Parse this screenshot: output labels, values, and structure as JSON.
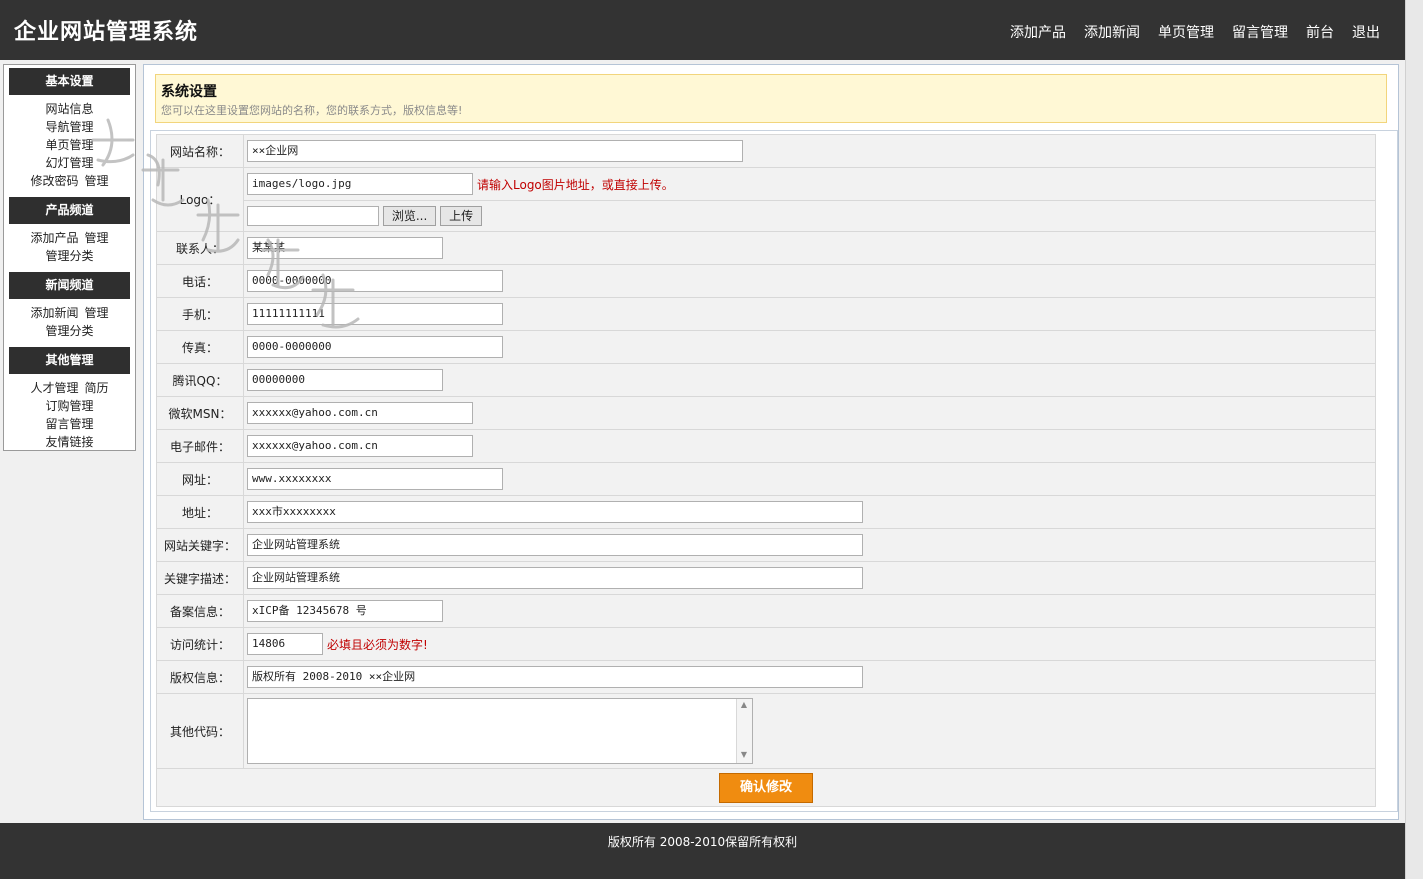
{
  "app_title": "企业网站管理系统",
  "top_nav": [
    "添加产品",
    "添加新闻",
    "单页管理",
    "留言管理",
    "前台",
    "退出"
  ],
  "sidebar": [
    {
      "heading": "基本设置",
      "items": [
        [
          "网站信息"
        ],
        [
          "导航管理"
        ],
        [
          "单页管理"
        ],
        [
          "幻灯管理"
        ],
        [
          "修改密码",
          "管理"
        ]
      ]
    },
    {
      "heading": "产品频道",
      "items": [
        [
          "添加产品",
          "管理"
        ],
        [
          "管理分类"
        ]
      ]
    },
    {
      "heading": "新闻频道",
      "items": [
        [
          "添加新闻",
          "管理"
        ],
        [
          "管理分类"
        ]
      ]
    },
    {
      "heading": "其他管理",
      "items": [
        [
          "人才管理",
          "简历"
        ],
        [
          "订购管理"
        ],
        [
          "留言管理"
        ],
        [
          "友情链接"
        ]
      ]
    }
  ],
  "notice": {
    "title": "系统设置",
    "desc": "您可以在这里设置您网站的名称，您的联系方式，版权信息等!"
  },
  "form": {
    "site_name": {
      "label": "网站名称：",
      "value": "××企业网"
    },
    "logo": {
      "label": "Logo：",
      "value": "images/logo.jpg",
      "hint": "请输入Logo图片地址，或直接上传。",
      "browse": "浏览...",
      "upload": "上传"
    },
    "contact": {
      "label": "联系人：",
      "value": "某某某"
    },
    "phone": {
      "label": "电话：",
      "value": "0000-0000000"
    },
    "mobile": {
      "label": "手机：",
      "value": "11111111111"
    },
    "fax": {
      "label": "传真：",
      "value": "0000-0000000"
    },
    "qq": {
      "label": "腾讯QQ：",
      "value": "00000000"
    },
    "msn": {
      "label": "微软MSN：",
      "value": "xxxxxx@yahoo.com.cn"
    },
    "email": {
      "label": "电子邮件：",
      "value": "xxxxxx@yahoo.com.cn"
    },
    "url": {
      "label": "网址：",
      "value": "www.xxxxxxxx"
    },
    "address": {
      "label": "地址：",
      "value": "xxx市xxxxxxxx"
    },
    "keywords": {
      "label": "网站关键字：",
      "value": "企业网站管理系统"
    },
    "description": {
      "label": "关键字描述：",
      "value": "企业网站管理系统"
    },
    "icp": {
      "label": "备案信息：",
      "value": "xICP备 12345678 号"
    },
    "visits": {
      "label": "访问统计：",
      "value": "14806",
      "hint": "必填且必须为数字!"
    },
    "copyright": {
      "label": "版权信息：",
      "value": "版权所有 2008-2010 ××企业网"
    },
    "other_code": {
      "label": "其他代码：",
      "value": ""
    },
    "submit": "确认修改"
  },
  "footer": "版权所有 2008-2010保留所有权利",
  "watermark": "老榕树网络",
  "colors": {
    "header_bg": "#333333",
    "hint": "#c00000",
    "submit_bg": "#f08c10",
    "notice_bg": "#fff8d5"
  }
}
